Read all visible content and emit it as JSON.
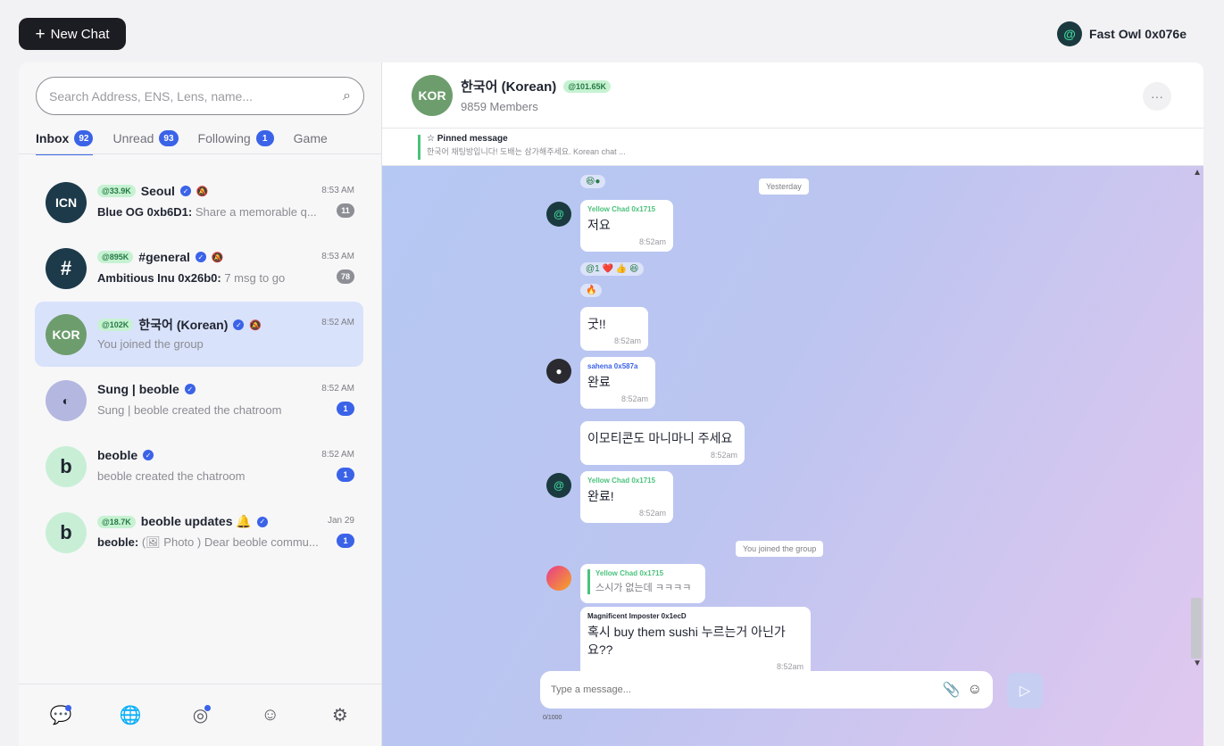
{
  "top": {
    "new_chat_label": "New Chat",
    "user_name": "Fast Owl 0x076e"
  },
  "search": {
    "placeholder": "Search Address, ENS, Lens, name..."
  },
  "tabs": [
    {
      "label": "Inbox",
      "count": "92"
    },
    {
      "label": "Unread",
      "count": "93"
    },
    {
      "label": "Following",
      "count": "1"
    },
    {
      "label": "Game"
    }
  ],
  "chats": [
    {
      "avatar": "ICN",
      "pill": "@33.9K",
      "name": "Seoul",
      "time": "8:53 AM",
      "sender": "Blue OG 0xb6D1:",
      "preview": " Share a memorable q...",
      "unread": "11",
      "color": "#1d3a4a"
    },
    {
      "avatar": "#",
      "pill": "@895K",
      "name": "#general",
      "time": "8:53 AM",
      "sender": "Ambitious Inu 0x26b0:",
      "preview": " 7 msg to go",
      "unread": "78",
      "color": "#1d3a4a"
    },
    {
      "avatar": "KOR",
      "pill": "@102K",
      "name": "한국어 (Korean)",
      "time": "8:52 AM",
      "sender": "",
      "preview": "You joined the group",
      "unread": "",
      "color": "#6d9d6d"
    },
    {
      "avatar": "◐",
      "pill": "",
      "name": "Sung | beoble",
      "time": "8:52 AM",
      "sender": "",
      "preview": "Sung | beoble created the chatroom",
      "unread": "1",
      "color": "#b4b8e0"
    },
    {
      "avatar": "b",
      "pill": "",
      "name": "beoble",
      "time": "8:52 AM",
      "sender": "",
      "preview": "beoble created the chatroom",
      "unread": "1",
      "color": "#c8efd6"
    },
    {
      "avatar": "b",
      "pill": "@18.7K",
      "name": "beoble updates 🔔",
      "time": "Jan 29",
      "sender": "beoble:",
      "preview": " (🖼 Photo ) Dear beoble commu...",
      "unread": "1",
      "color": "#c8efd6"
    }
  ],
  "header": {
    "avatar": "KOR",
    "title": "한국어 (Korean)",
    "pill": "@101.65K",
    "members": "9859 Members",
    "more": "···"
  },
  "pinned": {
    "title": "☆ Pinned message",
    "text": "한국어 채팅방입니다! 도배는 삼가해주세요. Korean chat ..."
  },
  "messages": {
    "date_yesterday": "Yesterday",
    "m1_sender": "Yellow Chad 0x1715",
    "m1_text": "저요",
    "m1_time": "8:52am",
    "m2_text": "굿!!",
    "m2_time": "8:52am",
    "reaction_row1": "@1 ❤️ 👍 😆",
    "reaction_row2": "🔥",
    "m3_sender": "sahena 0x587a",
    "m3_text": "완료",
    "m3_time": "8:52am",
    "m4_text": "이모티콘도 마니마니 주세요",
    "m4_time": "8:52am",
    "m5_sender": "Yellow Chad 0x1715",
    "m5_text": "완료!",
    "m5_time": "8:52am",
    "system_joined": "You joined the group",
    "m6_quote_sender": "Yellow Chad 0x1715",
    "m6_quote_text": "스시가 없는데 ㅋㅋㅋㅋ",
    "m6_sender": "Magnificent Imposter 0x1ecD",
    "m6_text": "혹시 buy them sushi 누르는거 아닌가요??",
    "m6_time": "8:52am"
  },
  "composer": {
    "placeholder": "Type a message...",
    "char_count": "0/1000"
  },
  "colors": {
    "accent": "#3b63e8",
    "pill_bg": "#c6f2d2",
    "dark_button": "#1c1d22"
  }
}
